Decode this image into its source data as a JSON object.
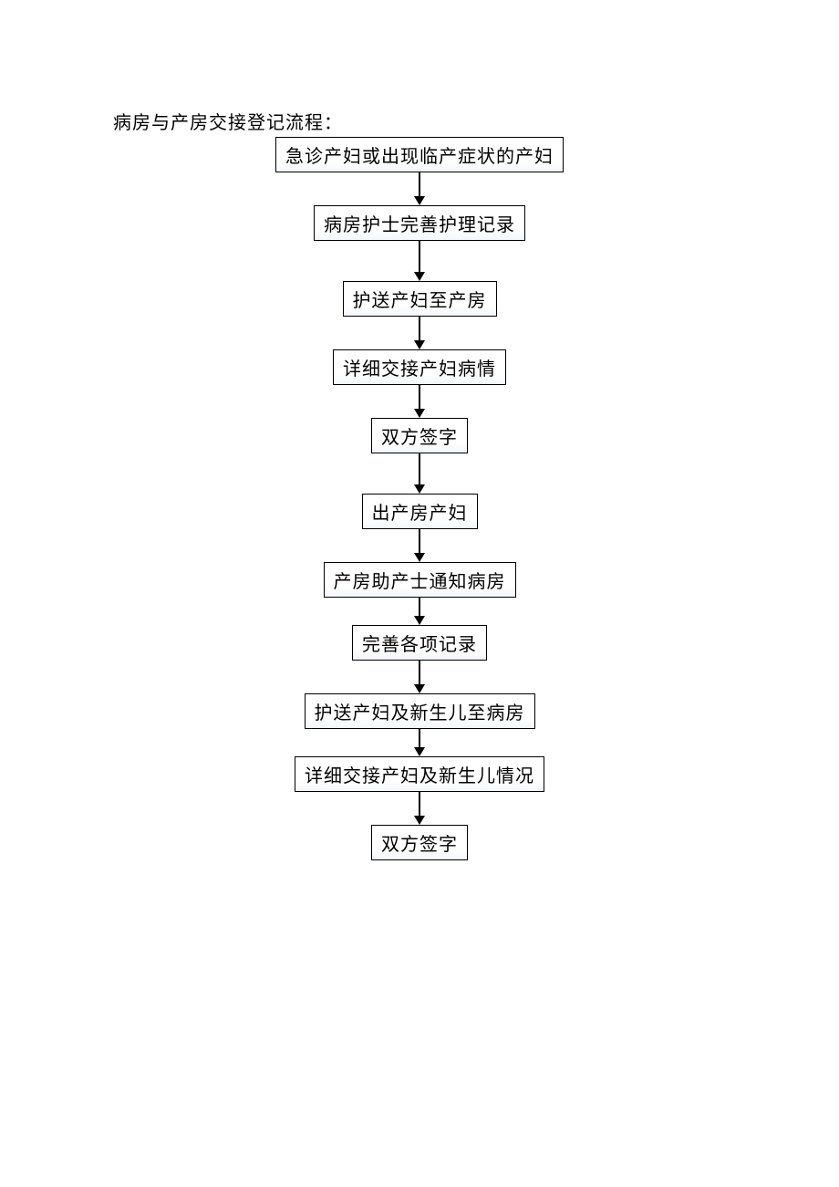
{
  "title": "病房与产房交接登记流程：",
  "flowchart": {
    "steps": [
      "急诊产妇或出现临产症状的产妇",
      "病房护士完善护理记录",
      "护送产妇至产房",
      "详细交接产妇病情",
      "双方签字",
      "出产房产妇",
      "产房助产士通知病房",
      "完善各项记录",
      "护送产妇及新生儿至病房",
      "详细交接产妇及新生儿情况",
      "双方签字"
    ]
  }
}
